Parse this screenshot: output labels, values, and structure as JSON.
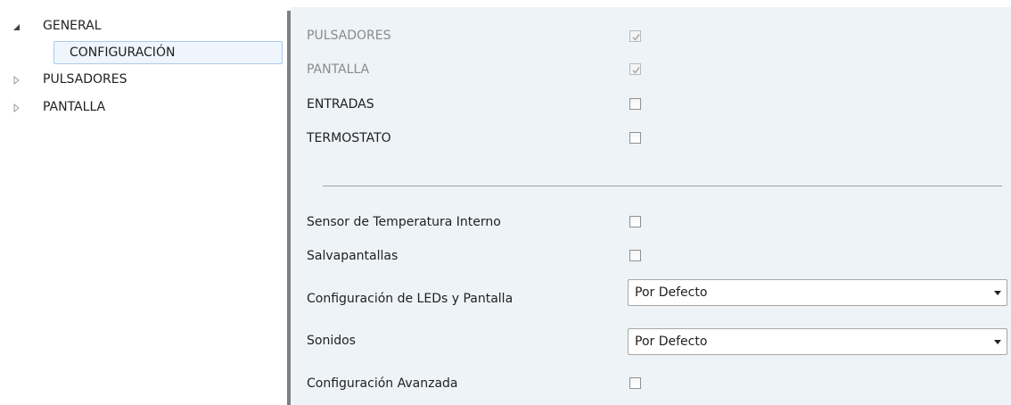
{
  "tree": {
    "items": [
      {
        "label": "GENERAL",
        "expander": "expanded-triangle-icon"
      },
      {
        "label": "CONFIGURACIÓN",
        "expander": null,
        "selected": true
      },
      {
        "label": "PULSADORES",
        "expander": "collapsed-triangle-icon"
      },
      {
        "label": "PANTALLA",
        "expander": "collapsed-triangle-icon"
      }
    ]
  },
  "modules": [
    {
      "label": "PULSADORES",
      "checked": true,
      "disabled": true
    },
    {
      "label": "PANTALLA",
      "checked": true,
      "disabled": true
    },
    {
      "label": "ENTRADAS",
      "checked": false,
      "disabled": false
    },
    {
      "label": "TERMOSTATO",
      "checked": false,
      "disabled": false
    }
  ],
  "options": {
    "internal_temp_sensor": {
      "label": "Sensor de Temperatura Interno",
      "checked": false
    },
    "screensaver": {
      "label": "Salvapantallas",
      "checked": false
    },
    "leds_config": {
      "label": "Configuración de LEDs y Pantalla",
      "value": "Por Defecto"
    },
    "sounds": {
      "label": "Sonidos",
      "value": "Por Defecto"
    },
    "advanced_config": {
      "label": "Configuración Avanzada",
      "checked": false
    }
  },
  "colors": {
    "panel_bg": "#eef3f7",
    "selection_border": "#a9cbee",
    "selection_bg": "#eef5fc",
    "disabled_text": "#8a8a8a"
  }
}
